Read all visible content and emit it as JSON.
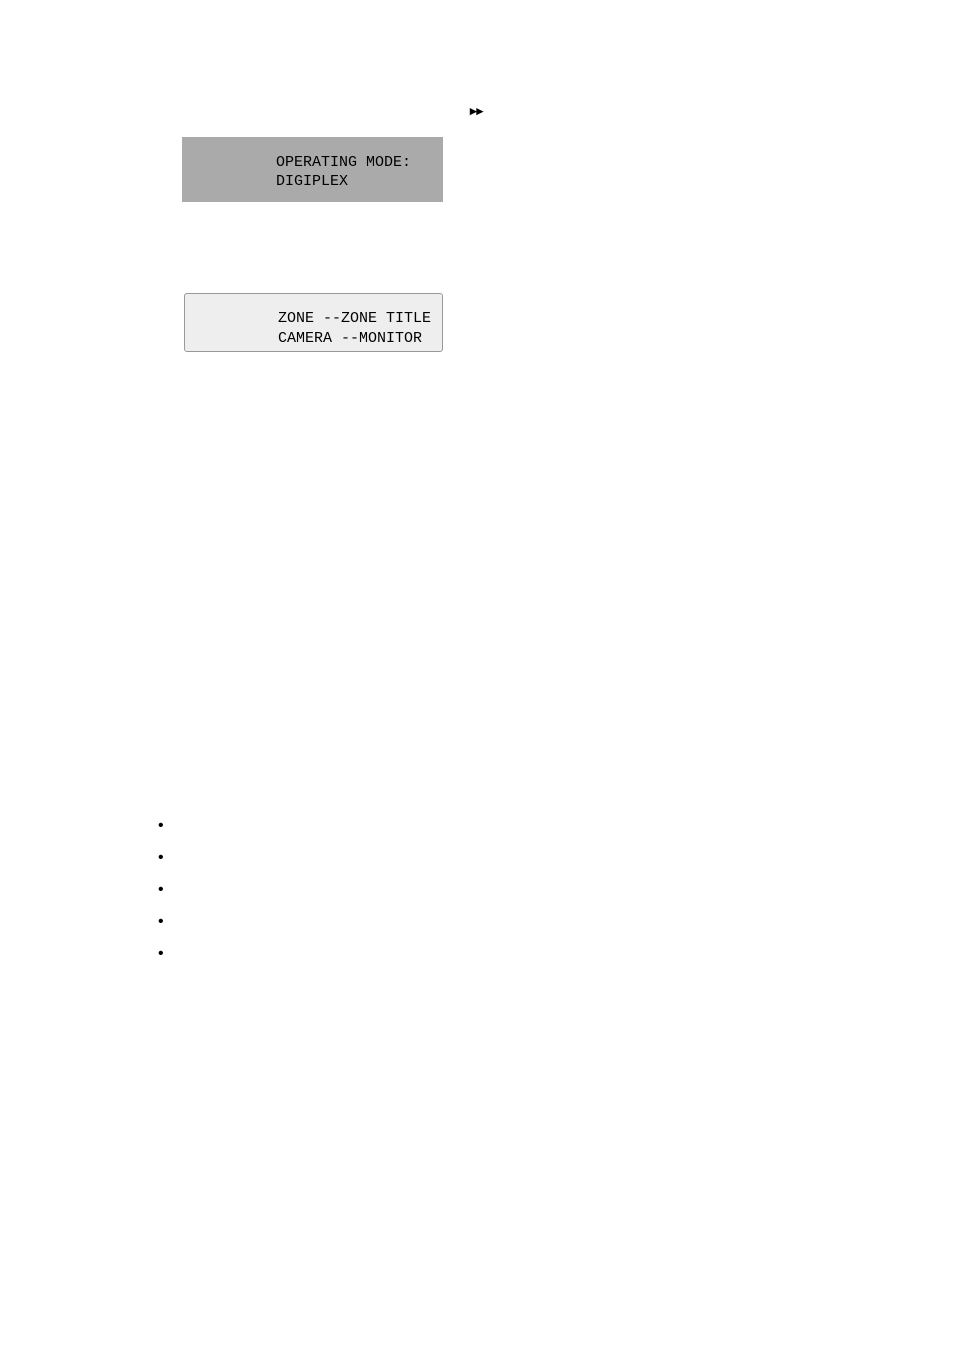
{
  "indicator": "▸▸",
  "display1": {
    "line1": "OPERATING MODE:",
    "line2": "DIGIPLEX"
  },
  "display2": {
    "line1": "ZONE --ZONE TITLE",
    "line2": "CAMERA --MONITOR"
  },
  "bullets": [
    "",
    "",
    "",
    "",
    ""
  ]
}
